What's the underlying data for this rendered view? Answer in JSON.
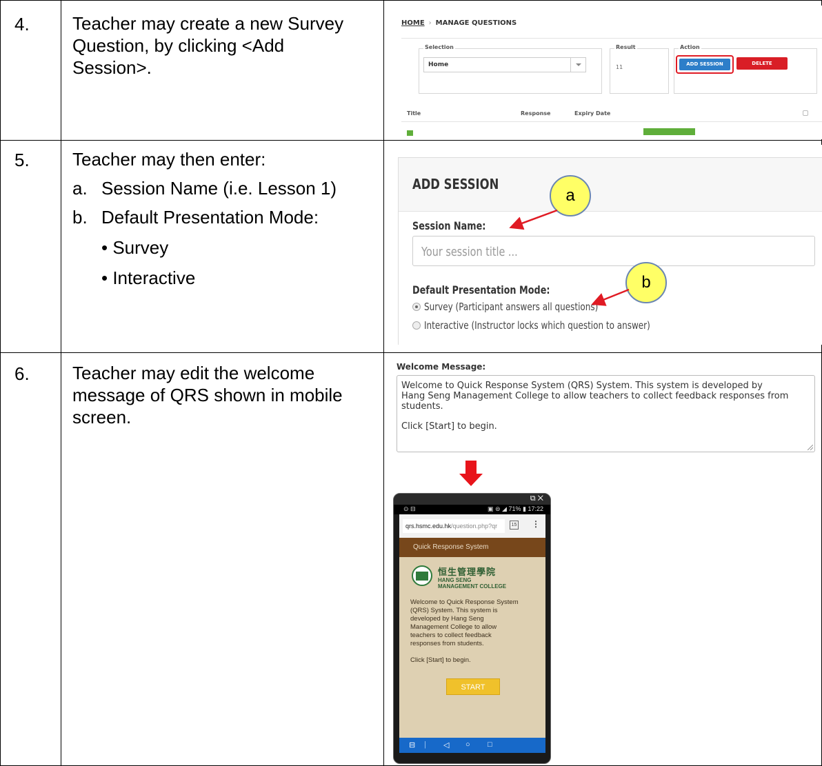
{
  "rows": [
    {
      "number": "4.",
      "text_lines": [
        "Teacher may create a new Survey",
        "Question, by clicking <Add",
        "Session>."
      ]
    },
    {
      "number": "5.",
      "intro": "Teacher may then enter:",
      "items": [
        {
          "marker": "a.",
          "text": "Session Name (i.e. Lesson 1)"
        },
        {
          "marker": "b.",
          "text": "Default Presentation Mode:"
        }
      ],
      "bullets": [
        "Survey",
        "Interactive"
      ]
    },
    {
      "number": "6.",
      "text_lines": [
        "Teacher may edit the welcome",
        "message of QRS shown in mobile",
        "screen."
      ]
    }
  ],
  "manage": {
    "home": "HOME",
    "separator": "›",
    "page": "MANAGE QUESTIONS",
    "selection_label": "Selection",
    "selection_value": "Home",
    "result_label": "Result",
    "result_value": "11",
    "action_label": "Action",
    "add_button": "ADD SESSION",
    "delete_button": "DELETE",
    "col_title": "Title",
    "col_response": "Response",
    "col_expiry": "Expiry Date"
  },
  "add_session": {
    "title": "ADD SESSION",
    "name_label": "Session Name:",
    "name_placeholder": "Your session title ...",
    "mode_label": "Default Presentation Mode:",
    "mode_survey": "Survey (Participant answers all questions)",
    "mode_interactive": "Interactive (Instructor locks which question to answer)",
    "callout_a": "a",
    "callout_b": "b"
  },
  "welcome": {
    "label": "Welcome Message:",
    "line1": "Welcome to Quick Response System (QRS) System.  This system is developed by",
    "line2": "Hang Seng Management College to allow teachers to collect feedback responses from",
    "line3": "students.",
    "line4": "Click [Start] to begin."
  },
  "phone": {
    "status_time": "17:22",
    "status_battery": "71%",
    "url_host": "qrs.hsmc.edu.hk",
    "url_path": "/question.php?qr",
    "tab_count": "15",
    "app_bar": "Quick Response System",
    "college_cn": "恒生管理學院",
    "college_en1": "HANG SENG",
    "college_en2": "MANAGEMENT COLLEGE",
    "body_l1": "Welcome to Quick Response System",
    "body_l2": "(QRS) System. This system is",
    "body_l3": "developed by Hang Seng",
    "body_l4": "Management College to allow",
    "body_l5": "teachers to collect feedback",
    "body_l6": "responses from students.",
    "body_l7": "Click [Start] to begin.",
    "start_button": "START"
  },
  "colors": {
    "accent_blue": "#2d7ec9",
    "delete_red": "#d91e26",
    "highlight_red": "#e01b24",
    "callout_yellow": "#ffff66",
    "phone_brown": "#77471b"
  }
}
